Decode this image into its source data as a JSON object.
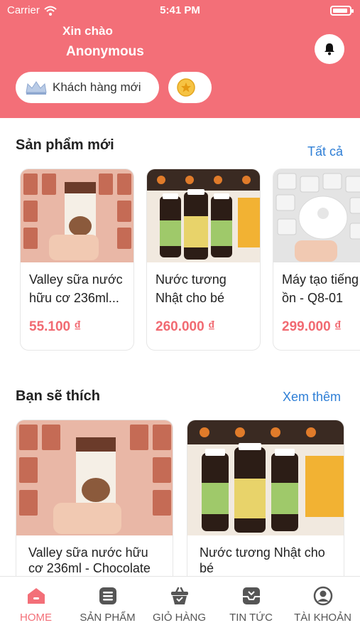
{
  "status_bar": {
    "carrier": "Carrier",
    "time": "5:41 PM",
    "battery_level": 0.9
  },
  "header": {
    "greeting": "Xin chào",
    "username": "Anonymous",
    "member_chip": {
      "label": "Khách hàng mới",
      "icon": "crown-icon"
    },
    "points_chip": {
      "icon": "star-coin-icon"
    },
    "notification_icon": "bell-icon"
  },
  "new_products": {
    "title": "Sản phẩm mới",
    "link": "Tất cả",
    "items": [
      {
        "name_line1": "Valley sữa nước",
        "name_line2": "hữu cơ 236ml...",
        "price": "55.100 ₫"
      },
      {
        "name_line1": "Nước tương",
        "name_line2": "Nhật cho bé",
        "price": "260.000 ₫"
      },
      {
        "name_line1": "Máy tạo tiếng",
        "name_line2": "ồn - Q8-01",
        "price": "299.000 ₫"
      }
    ]
  },
  "recommended": {
    "title": "Bạn sẽ thích",
    "link": "Xem thêm",
    "items": [
      {
        "name_line1": "Valley sữa nước hữu",
        "name_line2": "cơ 236ml - Chocolate"
      },
      {
        "name_line1": "Nước tương Nhật cho",
        "name_line2": "bé"
      }
    ]
  },
  "tabs": [
    {
      "label": "HOME",
      "icon": "home-icon",
      "active": true
    },
    {
      "label": "SẢN PHẨM",
      "icon": "list-icon",
      "active": false
    },
    {
      "label": "GIỎ HÀNG",
      "icon": "basket-icon",
      "active": false
    },
    {
      "label": "TIN TỨC",
      "icon": "inbox-icon",
      "active": false
    },
    {
      "label": "TÀI KHOẢN",
      "icon": "account-icon",
      "active": false
    }
  ],
  "colors": {
    "brand": "#f36f78",
    "price": "#f16a72",
    "link": "#2f7fd6"
  }
}
